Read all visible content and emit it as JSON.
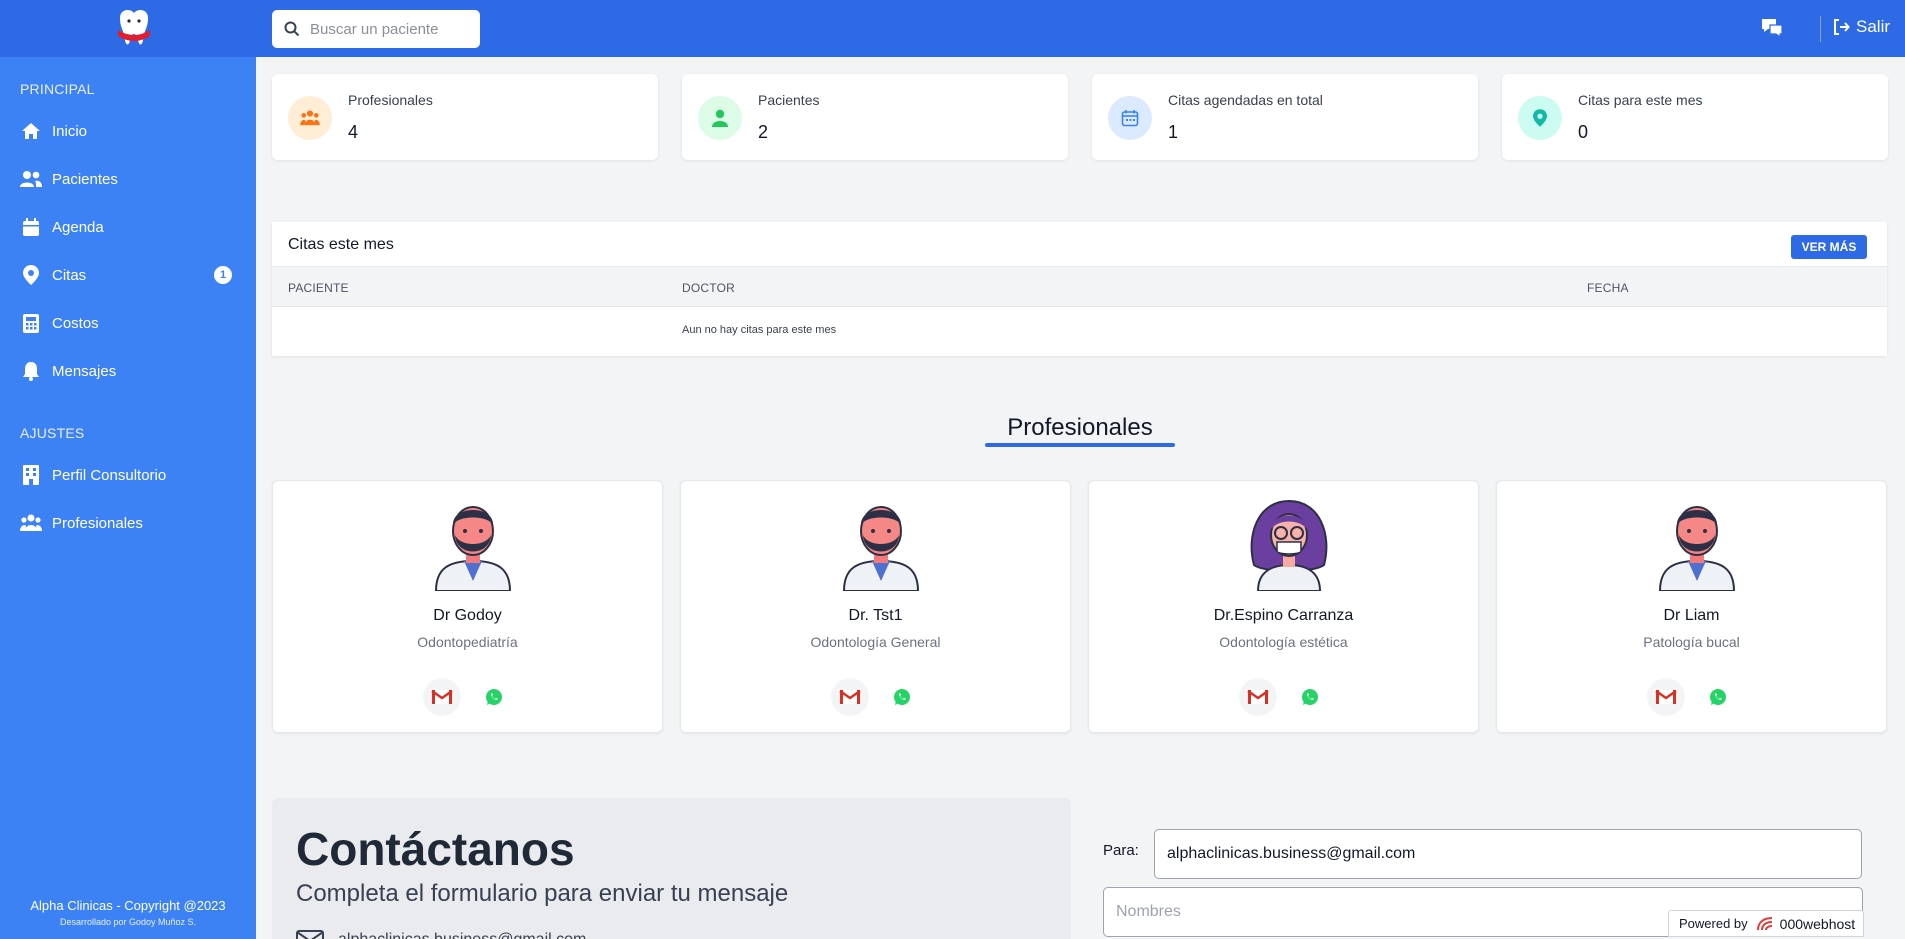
{
  "topbar": {
    "search_placeholder": "Buscar un paciente",
    "logout_label": "Salir"
  },
  "sidebar": {
    "section_principal": "PRINCIPAL",
    "section_ajustes": "AJUSTES",
    "items": [
      {
        "label": "Inicio",
        "icon": "home-icon"
      },
      {
        "label": "Pacientes",
        "icon": "users-icon"
      },
      {
        "label": "Agenda",
        "icon": "calendar-icon"
      },
      {
        "label": "Citas",
        "icon": "map-pin-icon",
        "badge": "1"
      },
      {
        "label": "Costos",
        "icon": "calculator-icon"
      },
      {
        "label": "Mensajes",
        "icon": "bell-icon"
      }
    ],
    "settings": [
      {
        "label": "Perfil Consultorio",
        "icon": "building-icon"
      },
      {
        "label": "Profesionales",
        "icon": "group-icon"
      }
    ],
    "copyright": "Alpha Clinicas - Copyright @2023",
    "developer": "Desarrollado por Godoy Muñoz S."
  },
  "stats": [
    {
      "label": "Profesionales",
      "value": "4",
      "color": "#f97316"
    },
    {
      "label": "Pacientes",
      "value": "2",
      "color": "#22c55e"
    },
    {
      "label": "Citas agendadas en total",
      "value": "1",
      "color": "#3b82f6"
    },
    {
      "label": "Citas para este mes",
      "value": "0",
      "color": "#14b8a6"
    }
  ],
  "citas": {
    "title": "Citas este mes",
    "ver_mas": "VER MÁS",
    "columns": [
      "PACIENTE",
      "DOCTOR",
      "FECHA"
    ],
    "empty": "Aun no hay citas para este mes"
  },
  "profesionales": {
    "title": "Profesionales",
    "cards": [
      {
        "name": "Dr Godoy",
        "specialty": "Odontopediatría"
      },
      {
        "name": "Dr. Tst1",
        "specialty": "Odontología General"
      },
      {
        "name": "Dr.Espino Carranza",
        "specialty": "Odontología estética"
      },
      {
        "name": "Dr Liam",
        "specialty": "Patología bucal"
      }
    ]
  },
  "contact": {
    "heading": "Contáctanos",
    "subheading": "Completa el formulario para enviar tu mensaje",
    "email_partial": "alphaclinicas.business@gmail.com",
    "para_label": "Para:",
    "para_value": "alphaclinicas.business@gmail.com",
    "nombres_placeholder": "Nombres"
  },
  "powered": {
    "label": "Powered by",
    "brand": "000webhost"
  },
  "colors": {
    "primary": "#2f6ae6",
    "sidebar": "#3d82f4"
  }
}
